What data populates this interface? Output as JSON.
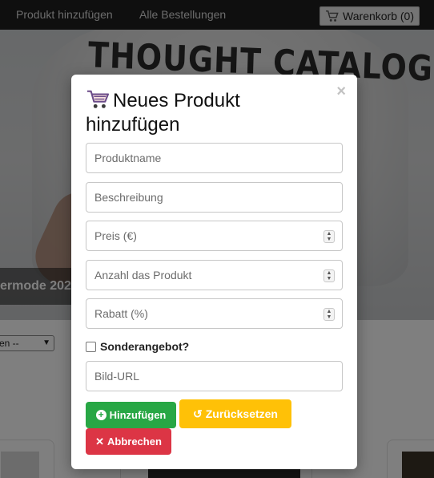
{
  "navbar": {
    "links": [
      "Produkt hinzufügen",
      "Alle Bestellungen"
    ],
    "cart_label": "Warenkorb (0)"
  },
  "hero": {
    "brand_text": "THOUGHT CATALOG",
    "caption": "ermode 202"
  },
  "filter": {
    "select_value": "en --"
  },
  "modal": {
    "title": "Neues Produkt hinzufügen",
    "fields": {
      "name_placeholder": "Produktname",
      "description_placeholder": "Beschreibung",
      "price_placeholder": "Preis (€)",
      "quantity_placeholder": "Anzahl das Produkt",
      "discount_placeholder": "Rabatt (%)",
      "image_url_placeholder": "Bild-URL"
    },
    "special_offer_label": "Sonderangebot?",
    "special_offer_checked": false,
    "buttons": {
      "add_label": "Hinzufügen",
      "reset_label": "Zurücksetzen",
      "cancel_label": "Abbrechen"
    },
    "close_symbol": "×"
  },
  "colors": {
    "add_button": "#28a745",
    "reset_button": "#ffc107",
    "cancel_button": "#dc3545",
    "navbar": "#1f1f1f"
  },
  "icons": [
    "cart-icon",
    "close-icon",
    "plus-circle-icon",
    "reset-icon",
    "x-icon",
    "spinner-icon"
  ]
}
